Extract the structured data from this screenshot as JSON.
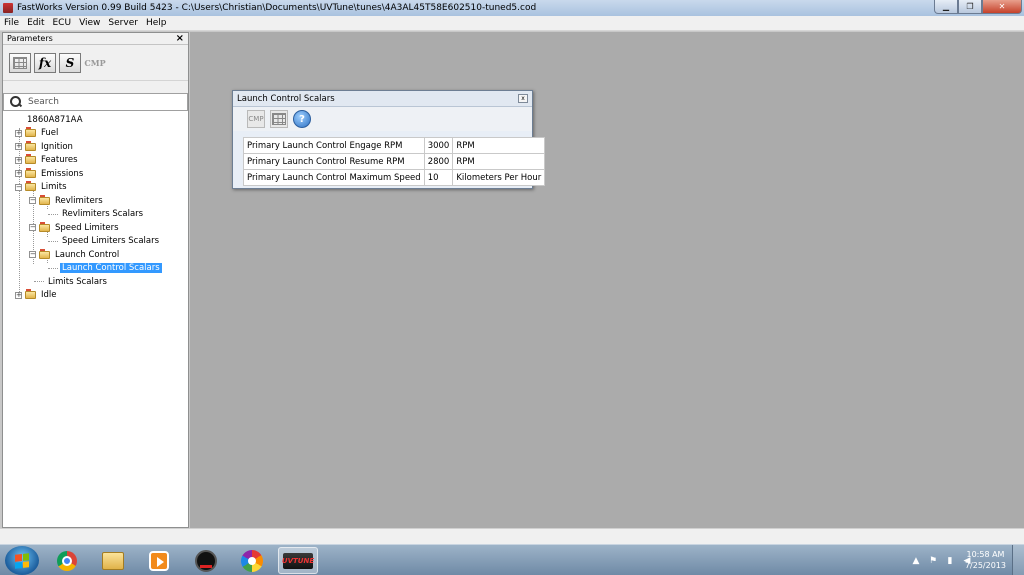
{
  "window": {
    "title": "FastWorks Version 0.99 Build 5423 - C:\\Users\\Christian\\Documents\\UVTune\\tunes\\4A3AL45T58E602510-tuned5.cod",
    "minimize": "▁",
    "restore": "❐",
    "close": "✕"
  },
  "menu": [
    "File",
    "Edit",
    "ECU",
    "View",
    "Server",
    "Help"
  ],
  "parameters_panel": {
    "title": "Parameters",
    "close": "×",
    "toolbar": {
      "table_btn": "",
      "fx_btn": "fx",
      "s_btn": "S",
      "cmp_btn": "CMP"
    },
    "search_placeholder": "Search",
    "tree": {
      "root": "1860A871AA",
      "fuel": "Fuel",
      "ignition": "Ignition",
      "features": "Features",
      "emissions": "Emissions",
      "limits": "Limits",
      "revlimiters": "Revlimiters",
      "revlimiters_scalars": "Revlimiters Scalars",
      "speed_limiters": "Speed Limiters",
      "speed_limiters_scalars": "Speed Limiters Scalars",
      "launch_control": "Launch Control",
      "launch_control_scalars": "Launch Control Scalars",
      "limits_scalars": "Limits Scalars",
      "idle": "Idle",
      "expand_symbol": "+",
      "collapse_symbol": "−"
    }
  },
  "dialog": {
    "title": "Launch Control Scalars",
    "close": "x",
    "toolbar": {
      "cmp": "CMP",
      "help": "?"
    },
    "rows": [
      {
        "name": "Primary Launch Control Engage RPM",
        "value": "3000",
        "unit": "RPM"
      },
      {
        "name": "Primary Launch Control Resume RPM",
        "value": "2800",
        "unit": "RPM"
      },
      {
        "name": "Primary Launch Control Maximum Speed",
        "value": "10",
        "unit": "Kilometers Per Hour"
      }
    ]
  },
  "taskbar": {
    "uvtune_label": "UVTUNE",
    "clock_time": "10:58 AM",
    "clock_date": "7/25/2013",
    "tray": {
      "up": "▲",
      "flag": "⚑",
      "signal": "▮",
      "volume": "◀"
    }
  },
  "colors": {
    "selection": "#3399ff",
    "workspace": "#ababab"
  }
}
